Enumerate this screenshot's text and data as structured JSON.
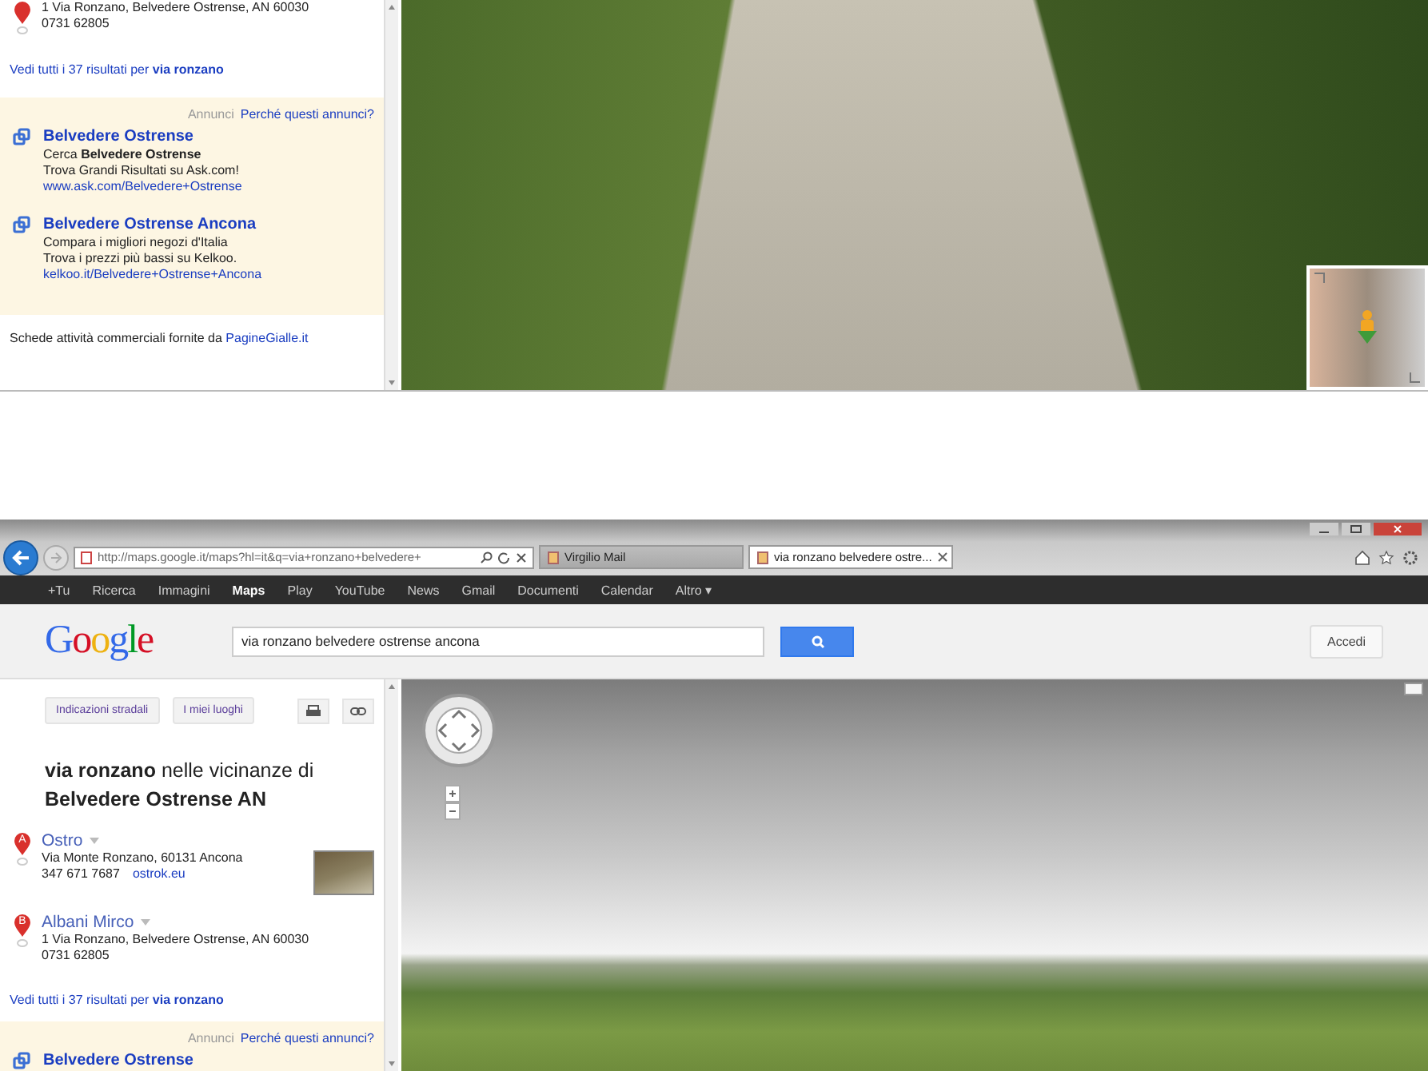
{
  "top_panel": {
    "sidebar": {
      "partial_result": {
        "address": "1 Via Ronzano, Belvedere Ostrense, AN 60030",
        "phone": "0731 62805"
      },
      "see_all": "Vedi tutti i 37 risultati per **via ronzano**",
      "ads": {
        "label": "Annunci",
        "why": "Perché questi annunci?",
        "items": [
          {
            "title": "Belvedere Ostrense",
            "lines": [
              "Cerca **Belvedere Ostrense**",
              "Trova Grandi Risultati su Ask.com!"
            ],
            "url": "www.ask.com/Belvedere+Ostrense"
          },
          {
            "title": "Belvedere Ostrense Ancona",
            "lines": [
              "Compara i migliori negozi d'Italia",
              "Trova i prezzi più bassi su Kelkoo."
            ],
            "url": "kelkoo.it/Belvedere+Ostrense+Ancona"
          }
        ]
      },
      "footer": {
        "text": "Schede attività commerciali fornite da",
        "link": "PagineGialle.it"
      }
    }
  },
  "browser": {
    "address": "http://maps.google.it/maps?hl=it&q=via+ronzano+belvedere+",
    "tabs": [
      {
        "title": "Virgilio Mail",
        "selected": false
      },
      {
        "title": "via ronzano belvedere ostre...",
        "selected": true
      }
    ],
    "google_bar": [
      {
        "label": "+Tu",
        "selected": false
      },
      {
        "label": "Ricerca",
        "selected": false
      },
      {
        "label": "Immagini",
        "selected": false
      },
      {
        "label": "Maps",
        "selected": true
      },
      {
        "label": "Play",
        "selected": false
      },
      {
        "label": "YouTube",
        "selected": false
      },
      {
        "label": "News",
        "selected": false
      },
      {
        "label": "Gmail",
        "selected": false
      },
      {
        "label": "Documenti",
        "selected": false
      },
      {
        "label": "Calendar",
        "selected": false
      },
      {
        "label": "Altro ▾",
        "selected": false
      }
    ],
    "logo": "Google",
    "search": {
      "value": "via ronzano belvedere ostrense ancona"
    },
    "sign_in": "Accedi",
    "sidebar": {
      "buttons": [
        "Indicazioni stradali",
        "I miei luoghi"
      ],
      "heading": "**via ronzano** nelle vicinanze di **Belvedere Ostrense AN**",
      "results": [
        {
          "marker": "A",
          "name": "Ostro",
          "address": "Via Monte Ronzano, 60131 Ancona",
          "phone": "347 671 7687",
          "website": "ostrok.eu",
          "thumbnail": true
        },
        {
          "marker": "B",
          "name": "Albani Mirco",
          "address": "1 Via Ronzano, Belvedere Ostrense, AN 60030",
          "phone": "0731 62805",
          "thumbnail": false
        }
      ],
      "see_all": "Vedi tutti i 37 risultati per **via ronzano**",
      "ads": {
        "label": "Annunci",
        "why": "Perché questi annunci?",
        "items": [
          {
            "title": "Belvedere Ostrense"
          }
        ]
      }
    }
  }
}
